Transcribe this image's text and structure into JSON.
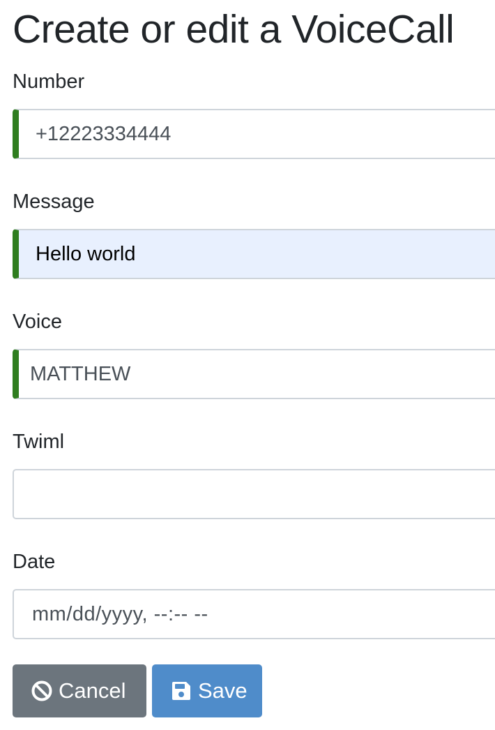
{
  "form": {
    "title": "Create or edit a VoiceCall",
    "number": {
      "label": "Number",
      "value": "+12223334444"
    },
    "message": {
      "label": "Message",
      "value": "Hello world"
    },
    "voice": {
      "label": "Voice",
      "value": "MATTHEW"
    },
    "twiml": {
      "label": "Twiml",
      "value": ""
    },
    "date": {
      "label": "Date",
      "placeholder": "mm/dd/yyyy, --:-- --"
    }
  },
  "actions": {
    "cancel_label": "Cancel",
    "cancel_icon": "ban-icon",
    "save_label": "Save",
    "save_icon": "floppy-disk-icon"
  },
  "colors": {
    "valid_border": "#2f7d1f",
    "autofill_bg": "#e8f0fe",
    "cancel_bg": "#6c757d",
    "save_bg": "#4f8cca"
  }
}
